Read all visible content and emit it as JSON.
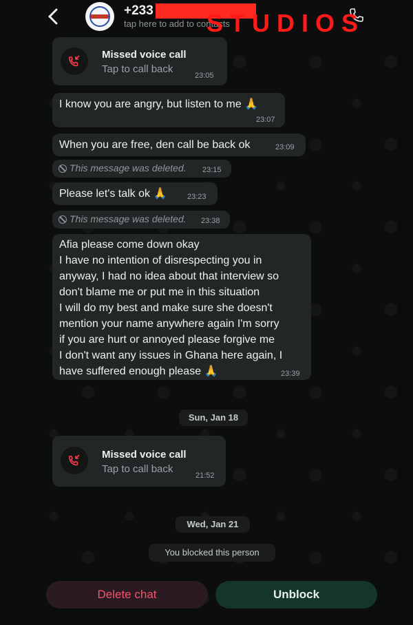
{
  "header": {
    "back_icon": "chevron-left-icon",
    "phone_prefix": "+233",
    "subtitle": "tap here to add to contacts",
    "watermark": "STUDIOS",
    "call_icon": "phone-icon"
  },
  "messages": [
    {
      "type": "call",
      "title": "Missed voice call",
      "subtitle": "Tap to call back",
      "time": "23:05"
    },
    {
      "type": "text",
      "text": "I know you are angry, but listen to me 🙏",
      "time": "23:07"
    },
    {
      "type": "text",
      "text": "When you are free, den call be back ok",
      "time": "23:09"
    },
    {
      "type": "deleted",
      "text": "This message was deleted.",
      "time": "23:15"
    },
    {
      "type": "text",
      "text": "Please let's talk ok 🙏",
      "time": "23:23"
    },
    {
      "type": "deleted",
      "text": "This message was deleted.",
      "time": "23:38"
    },
    {
      "type": "text",
      "text": "Afia please come down okay\nI have no intention of disrespecting you in\nanyway, I had no idea about that interview so\ndon't blame me or put me in this situation\nI will do my best and make sure she doesn't\nmention your name anywhere again I'm sorry\nif you are hurt or annoyed please forgive me\nI don't want any issues in Ghana here again, I\nhave suffered enough please 🙏",
      "time": "23:39"
    },
    {
      "type": "call",
      "title": "Missed voice call",
      "subtitle": "Tap to call back",
      "time": "21:52"
    }
  ],
  "dates": [
    "Sun, Jan 18",
    "Wed, Jan 21"
  ],
  "system_notice": "You blocked this person",
  "actions": {
    "delete_label": "Delete chat",
    "unblock_label": "Unblock"
  },
  "colors": {
    "bubble": "#232626",
    "missed_call_red": "#ff3b4e",
    "delete_text": "#f0566f",
    "unblock_bg": "#14362a",
    "watermark_red": "#ff1a1a"
  }
}
